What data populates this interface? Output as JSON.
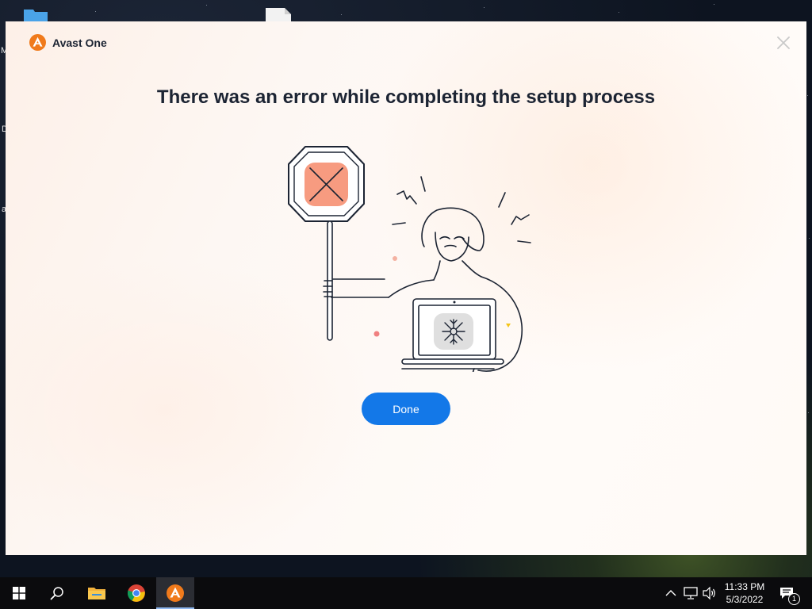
{
  "window": {
    "app_name": "Avast One",
    "title": "There was an error while completing the setup process",
    "done_label": "Done"
  },
  "desktop": {
    "partial_labels": [
      "M",
      "D",
      "a"
    ]
  },
  "taskbar": {
    "time": "11:33 PM",
    "date": "5/3/2022",
    "notification_count": "1"
  },
  "colors": {
    "accent_button": "#1378e8",
    "avast_orange": "#f07a1b",
    "stop_sign_fill": "#f79b80",
    "title_text": "#1c2433"
  },
  "icons": [
    "avast-logo",
    "close-icon",
    "windows-start-icon",
    "search-icon",
    "file-explorer-icon",
    "chrome-icon",
    "avast-taskbar-icon",
    "chevron-up-icon",
    "network-icon",
    "volume-icon",
    "notification-icon"
  ]
}
